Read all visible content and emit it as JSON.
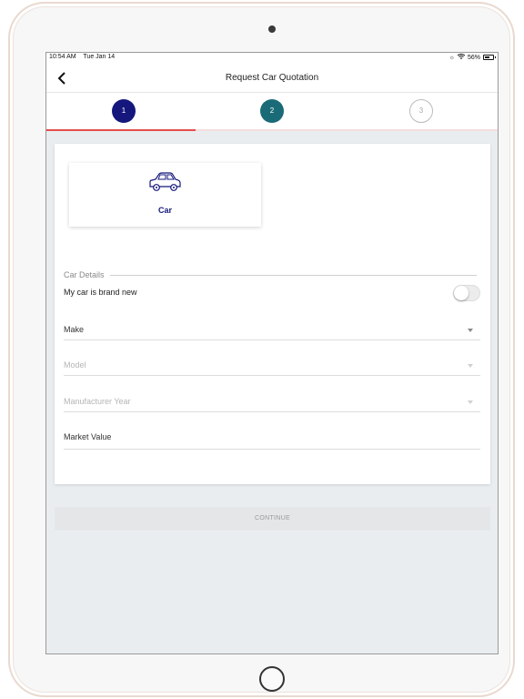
{
  "status_bar": {
    "time": "10:54 AM",
    "date": "Tue Jan 14",
    "battery": "56%"
  },
  "nav": {
    "back_icon": "chevron-left-icon",
    "title": "Request Car Quotation"
  },
  "stepper": {
    "steps": [
      "1",
      "2",
      "3"
    ],
    "active_step": 1,
    "progress": 0.33,
    "colors": {
      "step1": "#15177c",
      "step2": "#1a6b77",
      "progress": "#e44d4d"
    }
  },
  "vehicle": {
    "icon": "car-icon",
    "label": "Car"
  },
  "form": {
    "section_title": "Car Details",
    "brand_new_label": "My car is brand new",
    "brand_new_value": false,
    "make_label": "Make",
    "model_label": "Model",
    "year_label": "Manufacturer Year",
    "market_value_label": "Market Value"
  },
  "actions": {
    "continue_label": "CONTINUE"
  }
}
